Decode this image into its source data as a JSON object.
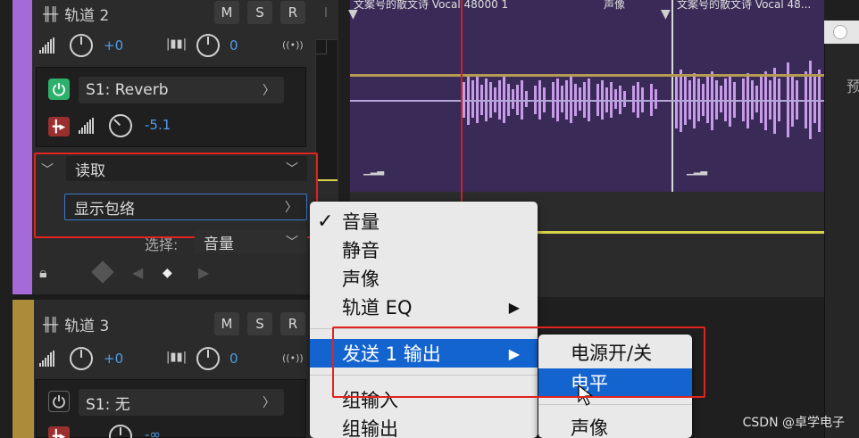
{
  "track2": {
    "name": "轨道 2",
    "m": "M",
    "s": "S",
    "r": "R",
    "i": "I",
    "volume_value": "+0",
    "pan_value": "0",
    "stereo_icon_text": "((•))",
    "effect_slot": "S1: Reverb",
    "send_value": "-5.1",
    "automation_mode": "读取",
    "show_envelope": "显示包络",
    "select_label": "选择:",
    "select_value": "音量"
  },
  "track3": {
    "name": "轨道 3",
    "m": "M",
    "s": "S",
    "r": "R",
    "volume_value": "+0",
    "pan_value": "0",
    "stereo_icon_text": "((•))",
    "effect_slot": "S1: 无",
    "send_value": "-∞"
  },
  "clips": {
    "clip1_title": "文案号的散文诗 Vocal 48000 1",
    "clip1_pan": "声像",
    "clip2_title": "文案号的散文诗 Vocal 48..."
  },
  "right_panel_text": "预",
  "menu_main": {
    "items": [
      "音量",
      "静音",
      "声像",
      "轨道 EQ",
      "发送 1 输出",
      "组输入",
      "组输出"
    ],
    "checked": "音量",
    "selected": "发送 1 输出"
  },
  "menu_sub": {
    "items": [
      "电源开/关",
      "电平",
      "声像"
    ],
    "selected": "电平"
  },
  "watermark": "CSDN @卓学电子",
  "colors": {
    "accent_blue": "#1464cf",
    "highlight_red": "#e0241f",
    "track2_color": "#a569d8",
    "track3_color": "#ac8c3b",
    "power_on": "#2eb06d",
    "value_blue": "#4f9ce8"
  }
}
